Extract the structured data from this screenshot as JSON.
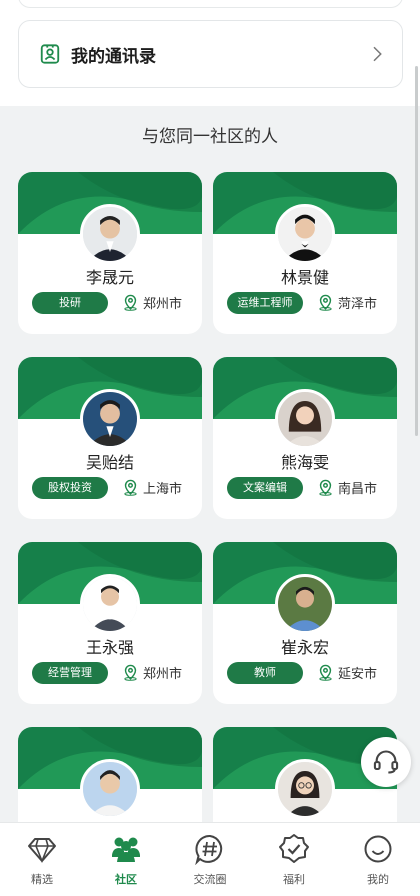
{
  "contacts": {
    "title": "我的通讯录"
  },
  "section": {
    "title": "与您同一社区的人"
  },
  "people": [
    {
      "name": "李晟元",
      "tag": "投研",
      "city": "郑州市"
    },
    {
      "name": "林景健",
      "tag": "运维工程师",
      "city": "菏泽市"
    },
    {
      "name": "吴贻结",
      "tag": "股权投资",
      "city": "上海市"
    },
    {
      "name": "熊海雯",
      "tag": "文案编辑",
      "city": "南昌市"
    },
    {
      "name": "王永强",
      "tag": "经营管理",
      "city": "郑州市"
    },
    {
      "name": "崔永宏",
      "tag": "教师",
      "city": "延安市"
    }
  ],
  "tabs": [
    {
      "label": "精选",
      "icon": "diamond-icon"
    },
    {
      "label": "社区",
      "icon": "community-icon",
      "active": true
    },
    {
      "label": "交流圈",
      "icon": "hashtag-chat-icon"
    },
    {
      "label": "福利",
      "icon": "badge-check-icon"
    },
    {
      "label": "我的",
      "icon": "smile-icon"
    }
  ],
  "colors": {
    "accent": "#1f8a4c",
    "tag_bg": "#1f7a47",
    "background": "#f0f2f3"
  }
}
